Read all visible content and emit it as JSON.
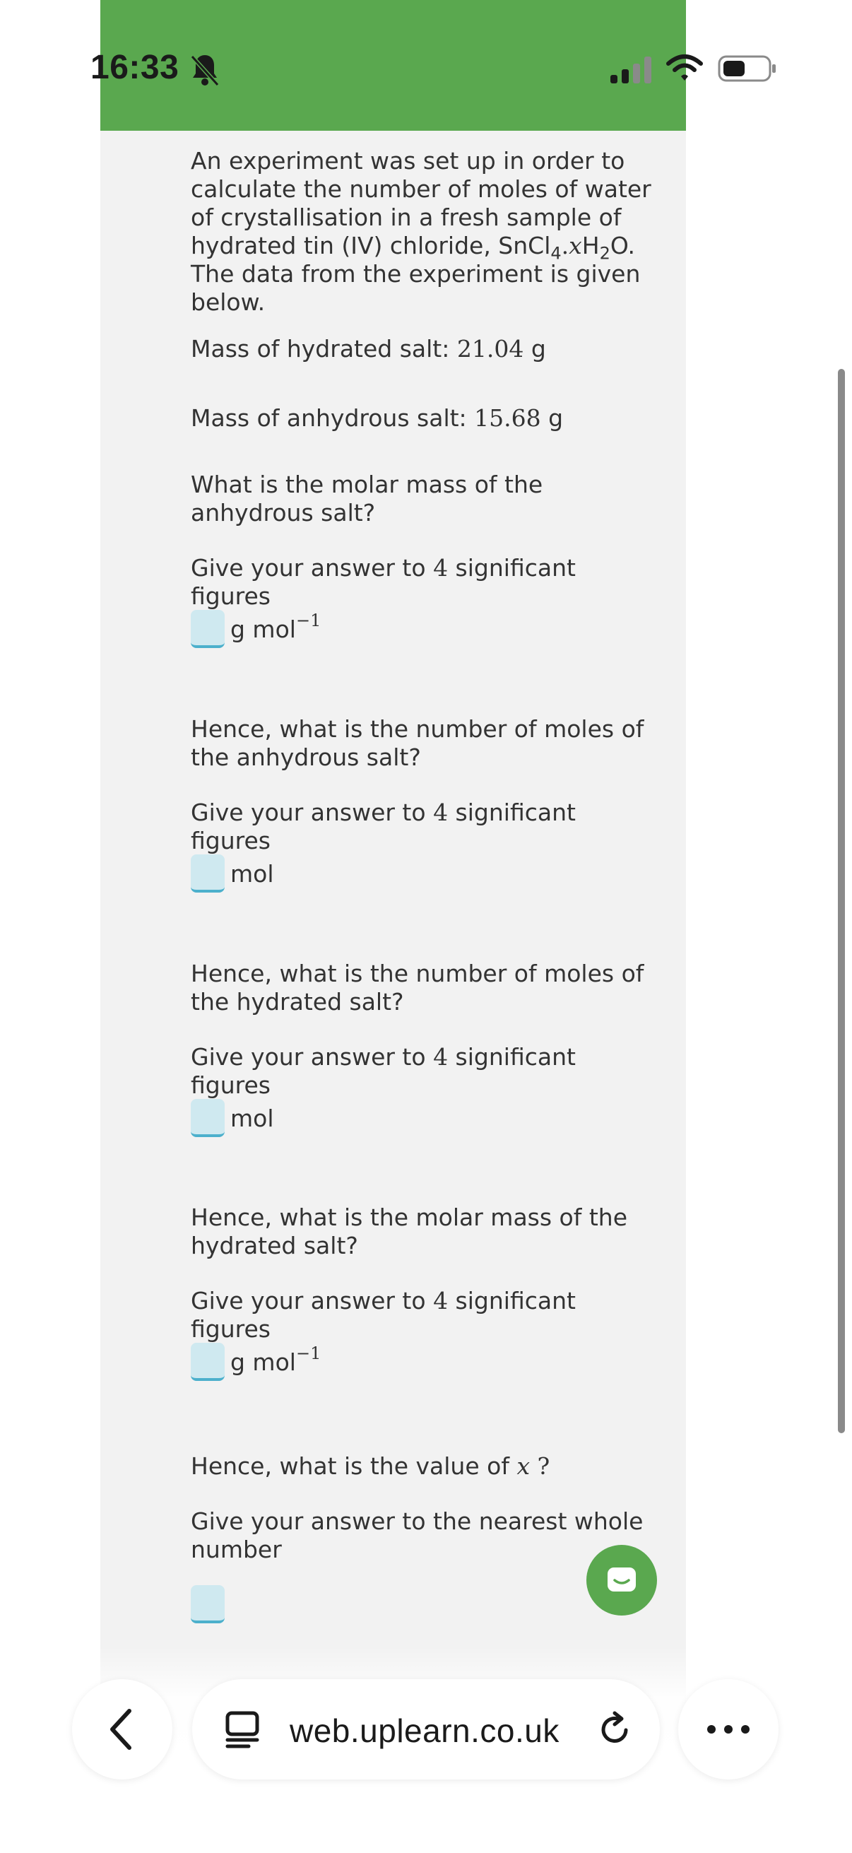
{
  "status_bar": {
    "time": "16:33"
  },
  "intro": {
    "text_a": "An experiment was set up in order to calculate the number of moles of water of crystallisation in a fresh sample of hydrated tin (IV) chloride, SnCl",
    "sub4": "4",
    "dot": ".",
    "x": "x",
    "h": "H",
    "sub2": "2",
    "o_the": "O. The data from the experiment is given below."
  },
  "mass_hydrated": {
    "label": "Mass of hydrated salt: ",
    "value": "21.04",
    "unit": " g"
  },
  "mass_anhydrous": {
    "label": "Mass of anhydrous salt: ",
    "value": "15.68",
    "unit": " g"
  },
  "questions": [
    {
      "prompt": "What is the molar mass of the anhydrous salt?",
      "instruction_pre": "Give your answer to ",
      "instruction_num": "4",
      "instruction_post": " significant figures",
      "unit": "g mol",
      "unit_sup": "−1"
    },
    {
      "prompt": "Hence, what is the number of moles of the anhydrous salt?",
      "instruction_pre": "Give your answer to ",
      "instruction_num": "4",
      "instruction_post": " significant figures",
      "unit": "mol"
    },
    {
      "prompt": "Hence, what is the number of moles of the hydrated salt?",
      "instruction_pre": "Give your answer to ",
      "instruction_num": "4",
      "instruction_post": " significant figures",
      "unit": "mol"
    },
    {
      "prompt": "Hence, what is the molar mass of the hydrated salt?",
      "instruction_pre": "Give your answer to ",
      "instruction_num": "4",
      "instruction_post": " significant figures",
      "unit": "g mol",
      "unit_sup": "−1"
    },
    {
      "prompt_pre": "Hence, what is the value of ",
      "prompt_var": "x",
      "prompt_post": " ?",
      "instruction": "Give your answer to the nearest whole number"
    }
  ],
  "browser": {
    "url": "web.uplearn.co.uk"
  },
  "colors": {
    "header_green": "#5aa84f",
    "panel_bg": "#f2f2f2",
    "answer_box": "#cfe9f0",
    "answer_border": "#4cb0cc"
  },
  "icons": [
    "bell-slash-icon",
    "signal-icon",
    "wifi-icon",
    "battery-icon",
    "chat-icon",
    "back-chevron-icon",
    "reader-icon",
    "reload-icon",
    "more-dots-icon"
  ]
}
